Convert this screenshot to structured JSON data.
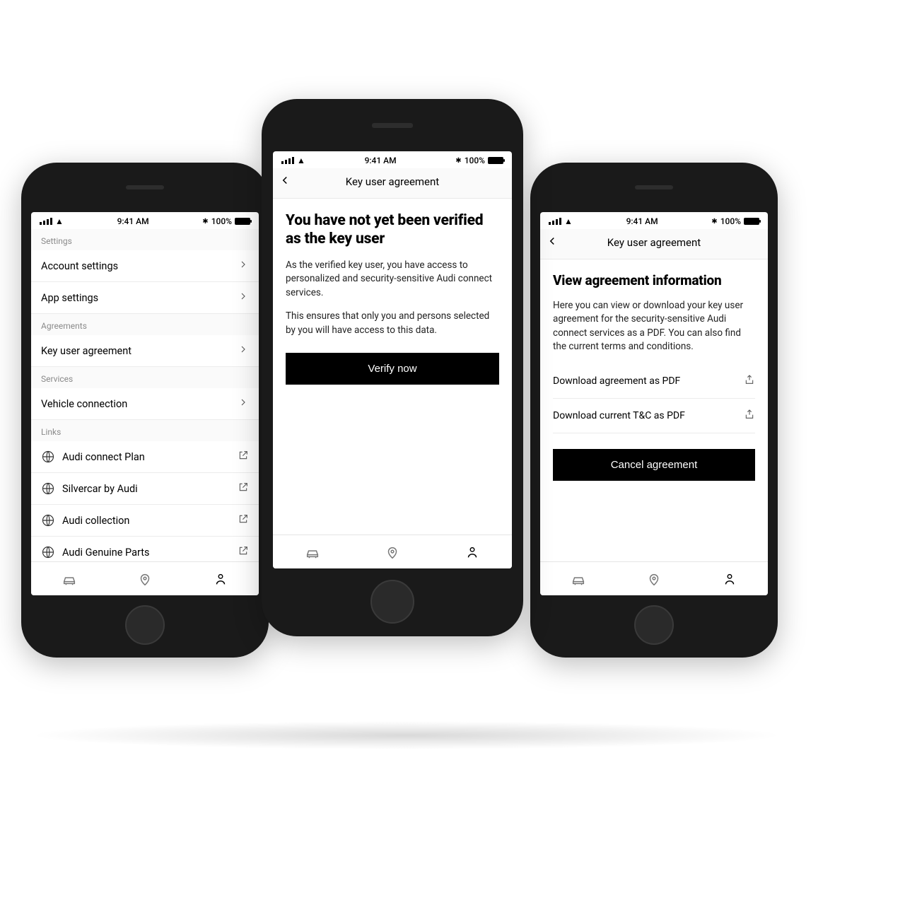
{
  "statusbar": {
    "time": "9:41 AM",
    "battery": "100%",
    "bt_glyph": "✱"
  },
  "left": {
    "sections": {
      "settings_label": "Settings",
      "agreements_label": "Agreements",
      "services_label": "Services",
      "links_label": "Links"
    },
    "rows": {
      "account": "Account settings",
      "app": "App settings",
      "key_user": "Key user agreement",
      "vehicle": "Vehicle connection",
      "link0": "Audi connect Plan",
      "link1": "Silvercar by Audi",
      "link2": "Audi collection",
      "link3": "Audi Genuine Parts"
    }
  },
  "center": {
    "nav_title": "Key user agreement",
    "heading": "You have not yet been verified as the key user",
    "para1": "As the verified key user, you have access to personalized and security-sensitive Audi connect services.",
    "para2": "This ensures that only you and persons selected by you will have access to this data.",
    "button": "Verify now"
  },
  "right": {
    "nav_title": "Key user agreement",
    "heading": "View agreement information",
    "para": "Here you can view or download your key user agreement for the security-sensitive Audi connect services as a PDF. You can also find the current terms and conditions.",
    "dl_agreement": "Download agreement as PDF",
    "dl_tc": "Download current T&C as PDF",
    "button": "Cancel agreement"
  }
}
